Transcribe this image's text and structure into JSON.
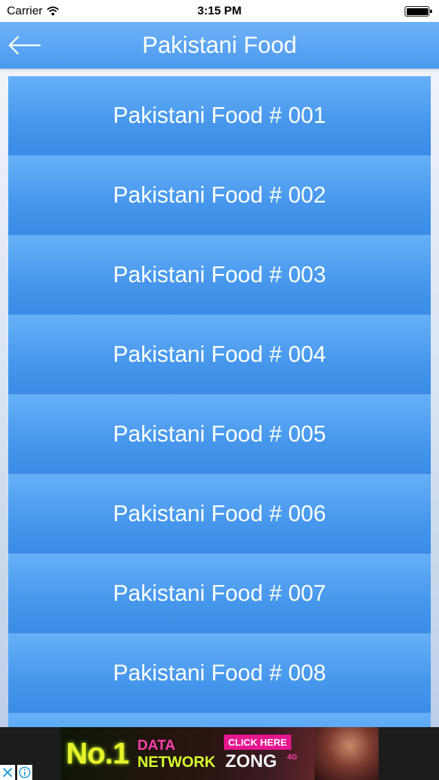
{
  "status_bar": {
    "carrier": "Carrier",
    "time": "3:15 PM"
  },
  "header": {
    "title": "Pakistani Food"
  },
  "list": {
    "items": [
      "Pakistani Food # 001",
      "Pakistani Food # 002",
      "Pakistani Food # 003",
      "Pakistani Food # 004",
      "Pakistani Food # 005",
      "Pakistani Food # 006",
      "Pakistani Food # 007",
      "Pakistani Food # 008",
      ""
    ]
  },
  "ad": {
    "no1": "No.1",
    "data": "DATA",
    "network": "NETWORK",
    "click_here": "CLICK HERE",
    "brand": "ZONG",
    "brand_tag": "4G"
  },
  "colors": {
    "header": "#4a98ee",
    "list_item": "#4697ec",
    "text": "#ffffff"
  }
}
